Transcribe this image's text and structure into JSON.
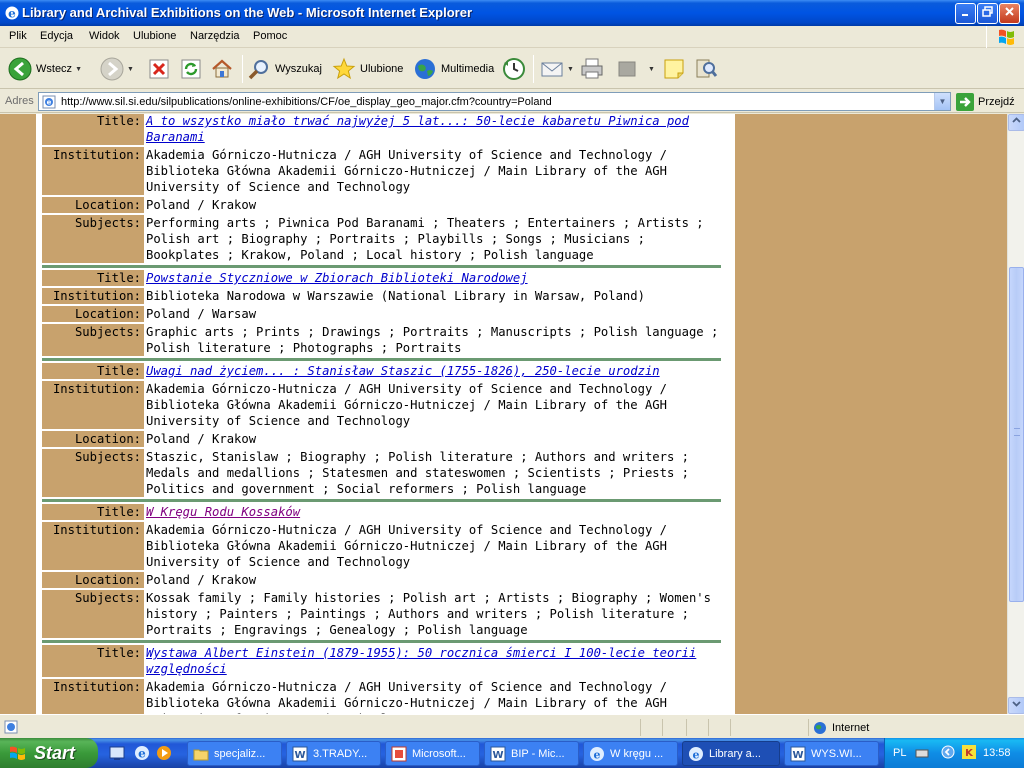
{
  "window": {
    "title": "Library and Archival Exhibitions on the Web - Microsoft Internet Explorer"
  },
  "menu": [
    "Plik",
    "Edycja",
    "Widok",
    "Ulubione",
    "Narzędzia",
    "Pomoc"
  ],
  "toolbar": {
    "back_label": "Wstecz",
    "search_label": "Wyszukaj",
    "favorites_label": "Ulubione",
    "media_label": "Multimedia"
  },
  "address": {
    "label": "Adres",
    "url": "http://www.sil.si.edu/silpublications/online-exhibitions/CF/oe_display_geo_major.cfm?country=Poland",
    "go_label": "Przejdź"
  },
  "labels": {
    "title": "Title:",
    "institution": "Institution:",
    "location": "Location:",
    "subjects": "Subjects:"
  },
  "records": [
    {
      "title": "A to wszystko miało trwać najwyżej 5 lat...: 50-lecie kabaretu Piwnica pod Baranami",
      "institution": "Akademia Górniczo-Hutnicza / AGH University of Science and Technology / Biblioteka Główna Akademii Górniczo-Hutniczej / Main Library of the AGH University of Science and Technology",
      "location": "Poland / Krakow",
      "subjects": "Performing arts ; Piwnica Pod Baranami ; Theaters ; Entertainers ; Artists ; Polish art ; Biography ; Portraits ; Playbills ; Songs ; Musicians ; Bookplates ; Krakow, Poland ; Local history ; Polish language"
    },
    {
      "title": "Powstanie Styczniowe w Zbiorach Biblioteki Narodowej",
      "institution": "Biblioteka Narodowa w Warszawie (National Library in Warsaw, Poland)",
      "location": "Poland / Warsaw",
      "subjects": "Graphic arts ; Prints ; Drawings ; Portraits ; Manuscripts ; Polish language ; Polish literature ; Photographs ; Portraits"
    },
    {
      "title": "Uwagi nad życiem... : Stanisław Staszic (1755-1826), 250-lecie urodzin",
      "institution": "Akademia Górniczo-Hutnicza / AGH University of Science and Technology / Biblioteka Główna Akademii Górniczo-Hutniczej / Main Library of the AGH University of Science and Technology",
      "location": "Poland / Krakow",
      "subjects": "Staszic, Stanislaw ; Biography ; Polish literature ; Authors and writers ; Medals and medallions ; Statesmen and stateswomen ; Scientists ; Priests ; Politics and government ; Social reformers ; Polish language"
    },
    {
      "title": "W Kręgu Rodu Kossaków",
      "institution": "Akademia Górniczo-Hutnicza / AGH University of Science and Technology / Biblioteka Główna Akademii Górniczo-Hutniczej / Main Library of the AGH University of Science and Technology",
      "location": "Poland / Krakow",
      "subjects": "Kossak family ; Family histories ; Polish art ; Artists ; Biography ; Women's history ; Painters ; Paintings ; Authors and writers ; Polish literature ; Portraits ; Engravings ; Genealogy ; Polish language"
    },
    {
      "title": "Wystawa Albert Einstein (1879-1955): 50 rocznica śmierci I 100-lecie teorii względności",
      "institution": "Akademia Górniczo-Hutnicza / AGH University of Science and Technology / Biblioteka Główna Akademii Górniczo-Hutniczej / Main Library of the AGH University of Science and Technology",
      "location": "",
      "subjects": ""
    }
  ],
  "status": {
    "zone_label": "Internet"
  },
  "taskbar": {
    "start_label": "Start",
    "tasks": [
      "specjaliz...",
      "3.TRADY...",
      "Microsoft...",
      "BIP - Mic...",
      "W kręgu ...",
      "Library a...",
      "WYS.WI..."
    ],
    "language": "PL",
    "clock": "13:58"
  },
  "colors": {
    "page_background": "#c8a26d",
    "record_divider": "#6b9a72",
    "link": "#0000cc",
    "visited_link": "#800080"
  }
}
